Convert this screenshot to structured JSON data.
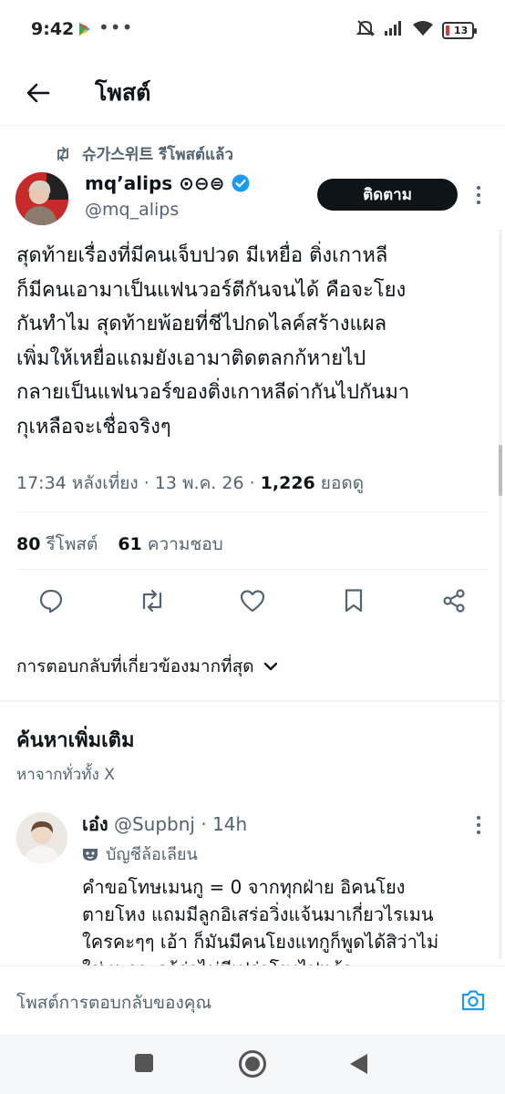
{
  "status_bar": {
    "time": "9:42",
    "dots": "•••",
    "battery": "13",
    "icons": [
      "play-store-icon",
      "mute-icon",
      "signal-icon",
      "wifi-icon",
      "battery-icon"
    ]
  },
  "header": {
    "title": "โพสต์"
  },
  "tweet": {
    "repost_label": "슈가스위트 รีโพสต์แล้ว",
    "author_name": "mq’alips ⊙⊖⊜",
    "author_handle": "@mq_alips",
    "follow_label": "ติดตาม",
    "text_lines": [
      "สุดท้ายเรื่องที่มีคนเจ็บปวด มีเหยื่อ ติ่งเกาหลี",
      "ก็มีคนเอามาเป็นแฟนวอร์ตีกันจนได้ คือจะโยง",
      "กันทำไม สุดท้ายพ้อยที่ชีไปกดไลค์สร้างแผล",
      "เพิ่มให้เหยื่อแถมยังเอามาติดตลกก้หายไป",
      "กลายเป็นแฟนวอร์ของติ่งเกาหลีด่ากันไปกันมา",
      "กุเหลือจะเชื่อจริงๆ"
    ],
    "meta_prefix": "17:34 หลังเที่ยง · 13 พ.ค. 26 · ",
    "views": "1,226",
    "views_label": " ยอดดู",
    "reposts_count": "80",
    "reposts_label": "รีโพสต์",
    "likes_count": "61",
    "likes_label": "ความชอบ",
    "verified_color": "#1d9bf0"
  },
  "actions": [
    "reply-icon",
    "repost-icon",
    "like-icon",
    "bookmark-icon",
    "share-icon"
  ],
  "sort": {
    "label": "การตอบกลับที่เกี่ยวข้องมากที่สุด"
  },
  "discover": {
    "title": "ค้นหาเพิ่มเติม",
    "subtitle": "หาจากทั่วทั้ง X"
  },
  "reply": {
    "name": "เอ๋ง",
    "handle_time": " @Supbnj · 14h",
    "parody_label": "บัญชีล้อเลียน",
    "text_lines": [
      "คำขอโทษเมนกู = 0 จากทุกฝ่าย อิคนโยง",
      "ตายโหง แถมมีลูกอิเสร่อวิ่งแจ้นมาเกี่ยวไรเมน",
      "ใครคะๆๆ เอ้า ก็มันมีคนโยงแทกูก็พูดได้สิว่าไม่",
      "ใช่ เพราะกูรู้ว่าไม่มีเปร่าโยงไปแล้ว"
    ]
  },
  "composer": {
    "placeholder": "โพสต์การตอบกลับของคุณ"
  },
  "colors": {
    "text": "#0f1419",
    "secondary": "#536471",
    "accent": "#1d9bf0"
  }
}
